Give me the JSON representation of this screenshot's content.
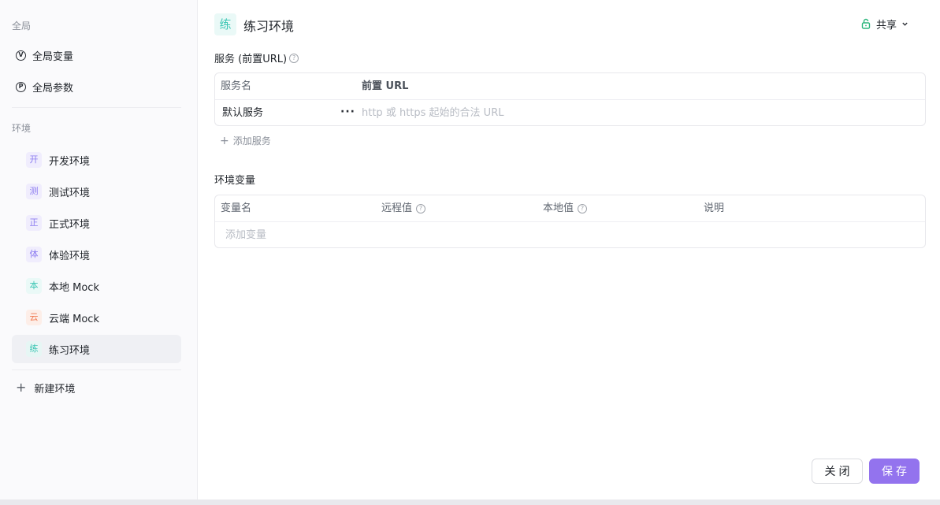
{
  "sidebar": {
    "global_title": "全局",
    "global_items": [
      {
        "icon": "V",
        "label": "全局变量"
      },
      {
        "icon": "P",
        "label": "全局参数"
      }
    ],
    "env_title": "环境",
    "envs": [
      {
        "badge": "开",
        "label": "开发环境",
        "color": "#8b7bf0",
        "bg": "#f0edfd"
      },
      {
        "badge": "测",
        "label": "测试环境",
        "color": "#8b7bf0",
        "bg": "#f0edfd"
      },
      {
        "badge": "正",
        "label": "正式环境",
        "color": "#8b7bf0",
        "bg": "#f0edfd"
      },
      {
        "badge": "体",
        "label": "体验环境",
        "color": "#8b7bf0",
        "bg": "#f0edfd"
      },
      {
        "badge": "本",
        "label": "本地 Mock",
        "color": "#3cc6b4",
        "bg": "#eaf9f7"
      },
      {
        "badge": "云",
        "label": "云端 Mock",
        "color": "#f07a52",
        "bg": "#fdeee8"
      },
      {
        "badge": "练",
        "label": "练习环境",
        "color": "#3cc6b4",
        "bg": "#e6f6f4"
      }
    ],
    "new_env_label": "新建环境"
  },
  "header": {
    "badge": "练",
    "title": "练习环境",
    "share_label": "共享"
  },
  "services": {
    "title": "服务 (前置URL)",
    "columns": [
      "服务名",
      "前置 URL"
    ],
    "rows": [
      {
        "name": "默认服务",
        "url_placeholder": "http 或 https 起始的合法 URL"
      }
    ],
    "add_label": "添加服务"
  },
  "env_vars": {
    "title": "环境变量",
    "columns": [
      "变量名",
      "远程值",
      "本地值",
      "说明"
    ],
    "add_placeholder": "添加变量"
  },
  "footer": {
    "close_label": "关闭",
    "save_label": "保存"
  },
  "colors": {
    "accent": "#9373ee",
    "active_env": "#3cc6b4",
    "share_lock": "#2cb67d"
  }
}
